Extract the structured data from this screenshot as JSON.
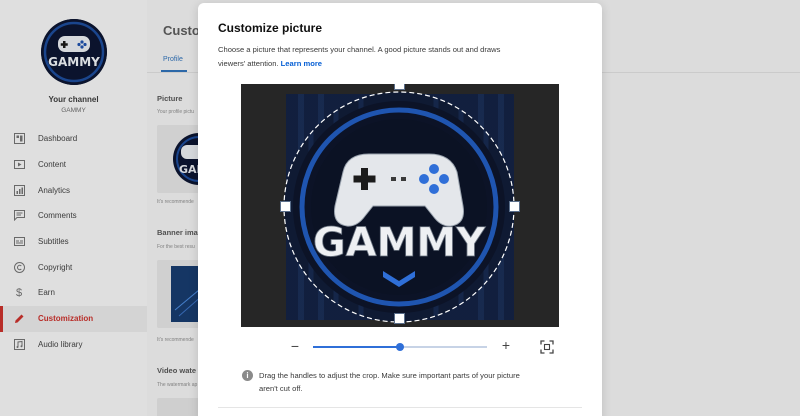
{
  "sidebar": {
    "avatar_text": "GAMMY",
    "your_channel": "Your channel",
    "channel_name": "GAMMY",
    "items": [
      {
        "label": "Dashboard",
        "icon": "dashboard-icon",
        "active": false
      },
      {
        "label": "Content",
        "icon": "content-icon",
        "active": false
      },
      {
        "label": "Analytics",
        "icon": "analytics-icon",
        "active": false
      },
      {
        "label": "Comments",
        "icon": "comments-icon",
        "active": false
      },
      {
        "label": "Subtitles",
        "icon": "subtitles-icon",
        "active": false
      },
      {
        "label": "Copyright",
        "icon": "copyright-icon",
        "active": false
      },
      {
        "label": "Earn",
        "icon": "earn-icon",
        "active": false
      },
      {
        "label": "Customization",
        "icon": "customization-icon",
        "active": true
      },
      {
        "label": "Audio library",
        "icon": "audio-library-icon",
        "active": false
      }
    ]
  },
  "background": {
    "title": "Custom",
    "tab": "Profile",
    "picture_heading": "Picture",
    "picture_sub": "Your profile pictu",
    "picture_note": "It's recommende",
    "banner_heading": "Banner ima",
    "banner_sub": "For the best resu",
    "banner_note": "It's recommende",
    "watermark_heading": "Video wate",
    "watermark_sub": "The watermark ap"
  },
  "dialog": {
    "title": "Customize picture",
    "description": "Choose a picture that represents your channel. A good picture stands out and draws viewers' attention.",
    "learn_more": "Learn more",
    "image_text": "GAMMY",
    "zoom_minus": "−",
    "zoom_plus": "+",
    "zoom_level": 0.5,
    "hint": "Drag the handles to adjust the crop. Make sure important parts of your picture aren't cut off.",
    "info_icon": "i"
  },
  "colors": {
    "accent": "#065fd4",
    "active_nav": "#c4302b",
    "slider": "#2f6fd8"
  }
}
